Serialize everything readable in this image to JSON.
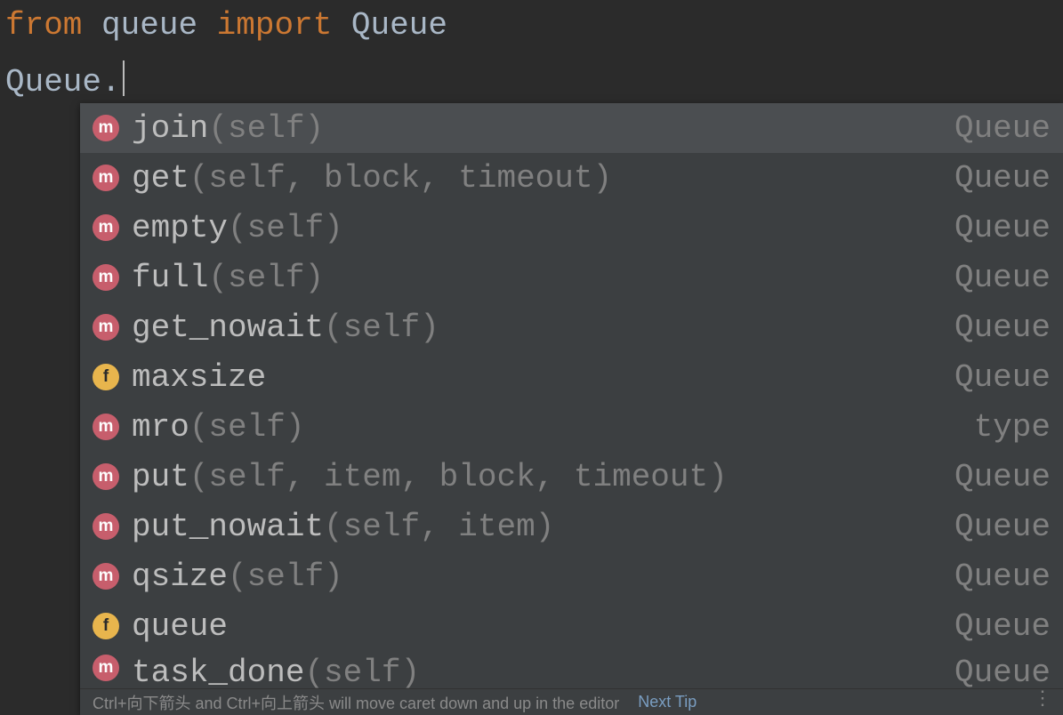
{
  "code": {
    "from_kw": "from",
    "module": "queue",
    "import_kw": "import",
    "class": "Queue",
    "typed": "Queue",
    "dot": "."
  },
  "completions": [
    {
      "kind": "m",
      "name": "join",
      "args": "(self)",
      "src": "Queue",
      "selected": true
    },
    {
      "kind": "m",
      "name": "get",
      "args": "(self, block, timeout)",
      "src": "Queue",
      "selected": false
    },
    {
      "kind": "m",
      "name": "empty",
      "args": "(self)",
      "src": "Queue",
      "selected": false
    },
    {
      "kind": "m",
      "name": "full",
      "args": "(self)",
      "src": "Queue",
      "selected": false
    },
    {
      "kind": "m",
      "name": "get_nowait",
      "args": "(self)",
      "src": "Queue",
      "selected": false
    },
    {
      "kind": "f",
      "name": "maxsize",
      "args": "",
      "src": "Queue",
      "selected": false
    },
    {
      "kind": "m",
      "name": "mro",
      "args": "(self)",
      "src": "type",
      "selected": false
    },
    {
      "kind": "m",
      "name": "put",
      "args": "(self, item, block, timeout)",
      "src": "Queue",
      "selected": false
    },
    {
      "kind": "m",
      "name": "put_nowait",
      "args": "(self, item)",
      "src": "Queue",
      "selected": false
    },
    {
      "kind": "m",
      "name": "qsize",
      "args": "(self)",
      "src": "Queue",
      "selected": false
    },
    {
      "kind": "f",
      "name": "queue",
      "args": "",
      "src": "Queue",
      "selected": false
    },
    {
      "kind": "m",
      "name": "task_done",
      "args": "(self)",
      "src": "Queue",
      "selected": false,
      "clipped": true
    }
  ],
  "hint": {
    "text_a": "Ctrl+向下箭头 and Ctrl+向上箭头 will move caret down and up in the editor",
    "link": "Next Tip"
  }
}
